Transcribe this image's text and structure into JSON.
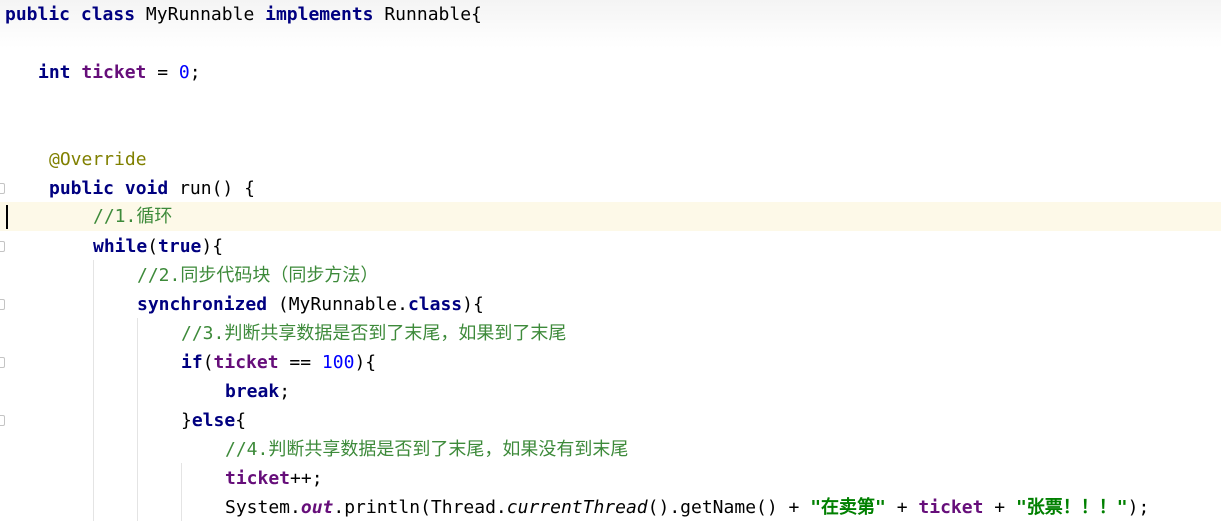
{
  "editor": {
    "lines": {
      "l1": {
        "kw1": "public",
        "kw2": "class",
        "name": "MyRunnable",
        "kw3": "implements",
        "iface": "Runnable{"
      },
      "l2": {
        "kw": "int",
        "field": "ticket",
        "eq": " = ",
        "num": "0",
        "end": ";"
      },
      "l3": {
        "ann": "@Override"
      },
      "l4": {
        "kw1": "public",
        "kw2": "void",
        "rest": "run() {"
      },
      "l5": {
        "comment": "//1.循环"
      },
      "l6": {
        "kw1": "while",
        "p1": "(",
        "kw2": "true",
        "p2": "){"
      },
      "l7": {
        "comment": "//2.同步代码块（同步方法）"
      },
      "l8": {
        "kw": "synchronized",
        "rest1": " (MyRunnable.",
        "kw2": "class",
        "rest2": "){"
      },
      "l9": {
        "comment": "//3.判断共享数据是否到了末尾，如果到了末尾"
      },
      "l10": {
        "kw": "if",
        "p1": "(",
        "field": "ticket",
        "op": " == ",
        "num": "100",
        "p2": "){"
      },
      "l11": {
        "kw": "break",
        "end": ";"
      },
      "l12": {
        "brace": "}",
        "kw": "else",
        "p": "{"
      },
      "l13": {
        "comment": "//4.判断共享数据是否到了末尾，如果没有到末尾"
      },
      "l14": {
        "field": "ticket",
        "op": "++;"
      },
      "l15": {
        "t1": "System.",
        "out": "out",
        "t2": ".println(Thread.",
        "ct": "currentThread",
        "t3": "().getName() + ",
        "s1": "\"在卖第\"",
        "t4": " + ",
        "field": "ticket",
        "t5": " + ",
        "s2": "\"张票！！！\"",
        "t6": ");"
      }
    }
  }
}
